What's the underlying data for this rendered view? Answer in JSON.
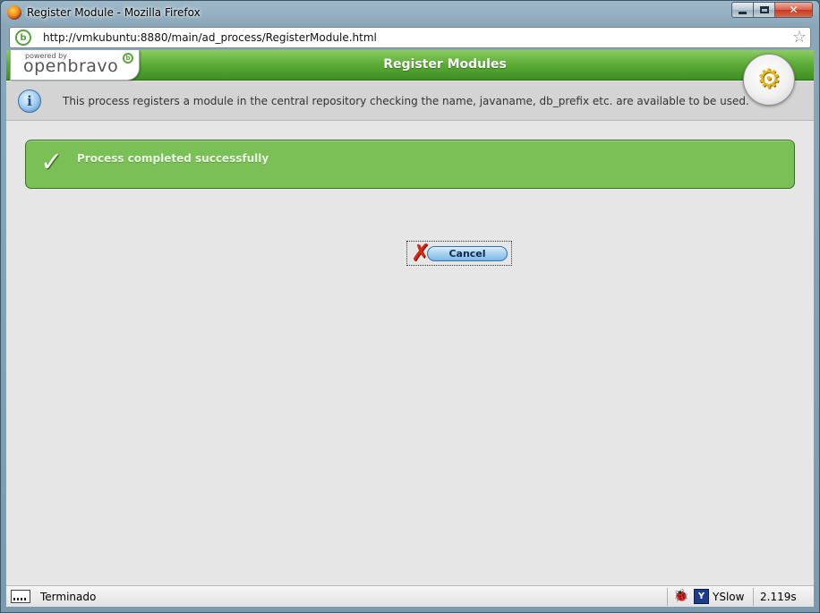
{
  "window": {
    "title": "Register Module - Mozilla Firefox",
    "minimize_glyph": "",
    "maximize_glyph": "",
    "close_glyph": "✕"
  },
  "address_bar": {
    "url": "http://vmkubuntu:8880/main/ad_process/RegisterModule.html",
    "site_icon": "openbravo-favicon",
    "bookmark_icon": "star-icon"
  },
  "header": {
    "powered_by": "powered by",
    "brand": "openbravo",
    "brand_mark": "b",
    "title": "Register Modules",
    "badge_icon": "gear-icon"
  },
  "info": {
    "icon": "i",
    "text": "This process registers a module in the central repository checking the name, javaname, db_prefix etc. are available to be used."
  },
  "message": {
    "icon": "✓",
    "text": "Process completed successfully"
  },
  "actions": {
    "cancel_label": "Cancel",
    "cancel_icon": "✗"
  },
  "status_bar": {
    "status_text": "Terminado",
    "yslow_label": "YSlow",
    "yslow_icon": "Y",
    "load_time": "2.119s"
  },
  "colors": {
    "header_green": "#5fae3a",
    "success_green": "#7bbf57",
    "cancel_red": "#d32a18"
  }
}
